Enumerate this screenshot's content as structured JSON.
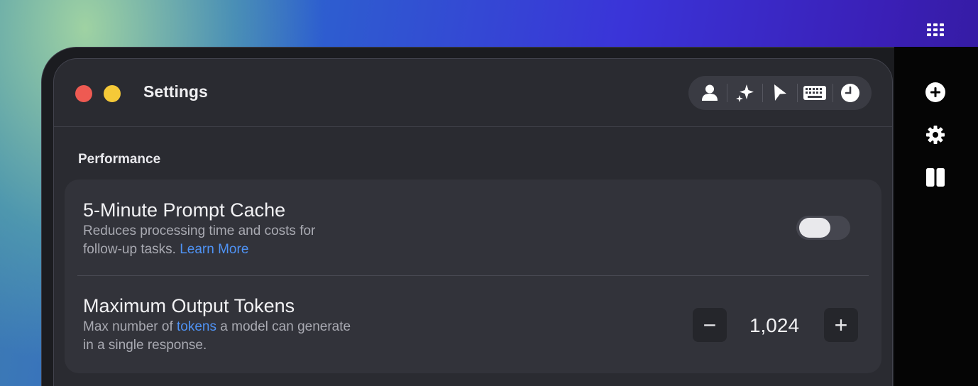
{
  "window": {
    "title": "Settings"
  },
  "toolbar": {
    "items": [
      {
        "icon": "person-icon"
      },
      {
        "icon": "sparkles-icon"
      },
      {
        "icon": "cursor-icon"
      },
      {
        "icon": "keyboard-icon"
      },
      {
        "icon": "clock-icon"
      }
    ]
  },
  "section": {
    "title": "Performance"
  },
  "prompt_cache": {
    "title": "5-Minute Prompt Cache",
    "desc_line1": "Reduces processing time and costs for",
    "desc_line2": "follow-up tasks.",
    "link": "Learn More",
    "enabled": false
  },
  "max_tokens": {
    "title": "Maximum Output Tokens",
    "desc_prefix": "Max number of",
    "link": "tokens",
    "desc_suffix": "a model can generate",
    "desc_line2": "in a single response.",
    "value": "1,024",
    "minus_label": "−",
    "plus_label": "+"
  },
  "sidebar": {
    "icons": [
      "grid-icon",
      "plus-circle-icon",
      "gear-icon",
      "columns-icon"
    ]
  },
  "colors": {
    "link": "#4f93f5",
    "close": "#ee5a52",
    "minimize": "#f5c938"
  }
}
